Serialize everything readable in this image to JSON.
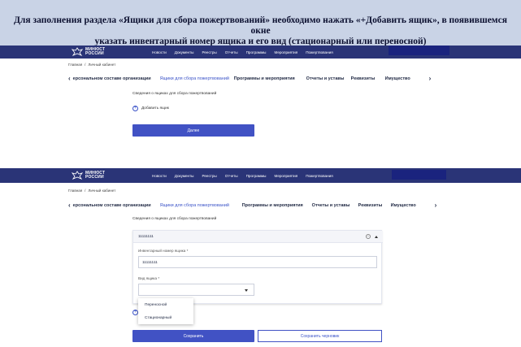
{
  "instruction": {
    "line1": "Для заполнения раздела «Ящики для сбора пожертвований»  необходимо нажать «+Добавить ящик», в появившемся окне",
    "line2": "указать инвентарный номер ящика и  его вид (стационарный или переносной)"
  },
  "header": {
    "logo_line1": "МИНЮСТ",
    "logo_line2": "РОССИИ",
    "nav": [
      "Новости",
      "Документы",
      "Реестры",
      "Отчеты",
      "Программы",
      "Мероприятия",
      "Пожертвования"
    ]
  },
  "breadcrumb": {
    "home": "Главная",
    "sep": "/",
    "current": "Личный кабинет"
  },
  "tabs": [
    "ерсональном составе организации",
    "Ящики для сбора пожертвований",
    "Программы и мероприятия",
    "Отчеты и уставы",
    "Реквизиты",
    "Имущество"
  ],
  "nav_arrows": {
    "prev": "‹",
    "next": "›"
  },
  "step1": {
    "section_title": "Сведения о ящиках для сбора пожертвований",
    "add_box": "Добавить ящик",
    "next_button": "Далее"
  },
  "step2": {
    "section_title": "Сведения о ящиках для сбора пожертвований",
    "box_header": "11111111",
    "inventory_label": "Инвентарный номер ящика *",
    "inventory_value": "11111111",
    "type_label": "Вид ящика *",
    "type_options": [
      "Переносной",
      "Стационарный"
    ],
    "save_button": "Сохранить",
    "draft_button": "Сохранить черновик"
  },
  "colors": {
    "header_bg": "#2a3477",
    "accent": "#4152c4",
    "instruction_bg": "#c9d3e6"
  }
}
